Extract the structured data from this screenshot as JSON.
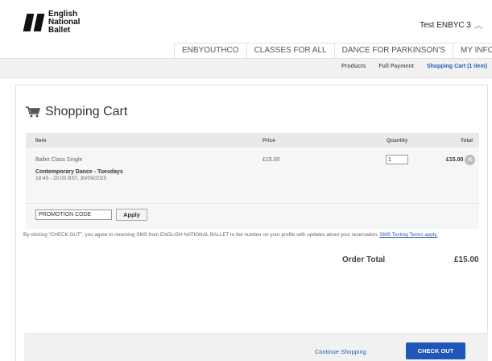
{
  "header": {
    "logo_lines": [
      "English",
      "National",
      "Ballet"
    ],
    "user_name": "Test ENBYC 3"
  },
  "nav": {
    "tabs": [
      "ENBYOUTHCO",
      "CLASSES FOR ALL",
      "DANCE FOR PARKINSON'S",
      "MY INFO"
    ]
  },
  "subnav": {
    "links": [
      "Products",
      "Full Payment",
      "Shopping Cart (1 item)"
    ],
    "active_index": 2
  },
  "cart": {
    "title": "Shopping Cart",
    "columns": {
      "item": "Item",
      "price": "Price",
      "quantity": "Quantity",
      "total": "Total"
    },
    "items": [
      {
        "class_type": "Ballet Class Single",
        "name": "Contemporary Dance - Tuesdays",
        "time": "18:45 - 20:00 BST, 30/09/2025",
        "price": "£15.00",
        "quantity": "1",
        "total": "£15.00"
      }
    ],
    "promo": {
      "value": "PROMOTION CODE",
      "apply_label": "Apply"
    }
  },
  "disclaimer": {
    "text": "By clicking \"CHECK OUT\", you agree to receiving SMS from ENGLISH NATIONAL BALLET to the number on your profile with updates about your reservation.",
    "link": "SMS Texting Terms apply."
  },
  "order_total": {
    "label": "Order Total",
    "value": "£15.00"
  },
  "actions": {
    "continue_label": "Continue Shopping",
    "checkout_label": "CHECK OUT"
  },
  "colors": {
    "accent": "#1f57b8",
    "link": "#2a5bb8"
  },
  "icons": [
    "logo-mark",
    "chevron-up-icon",
    "shopping-cart-icon",
    "remove-icon"
  ]
}
